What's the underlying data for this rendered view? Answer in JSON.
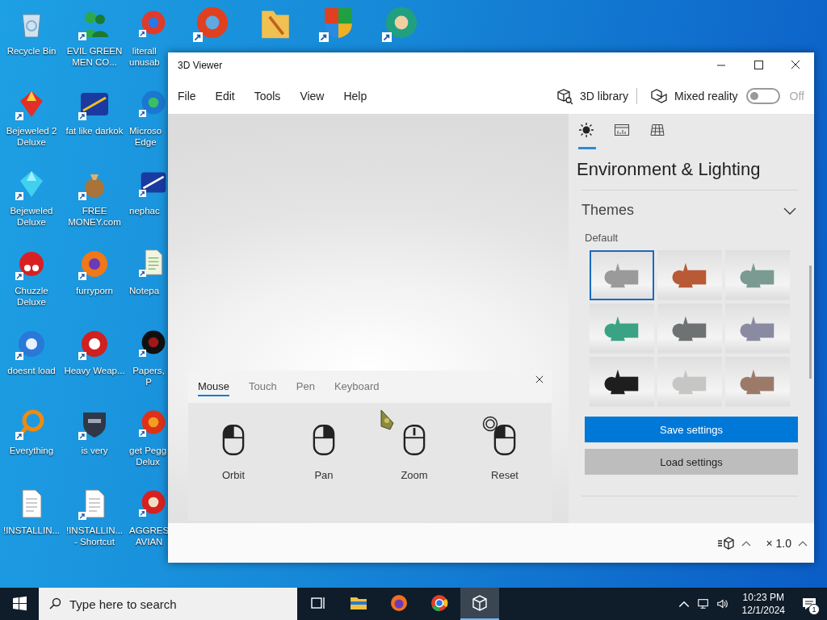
{
  "desktop": {
    "columns": [
      {
        "icons": [
          {
            "label": "Recycle Bin",
            "shortcut": false
          },
          {
            "label": "Bejeweled 2 Deluxe",
            "shortcut": true
          },
          {
            "label": "Bejeweled Deluxe",
            "shortcut": true
          },
          {
            "label": "Chuzzle Deluxe",
            "shortcut": true
          },
          {
            "label": "doesnt load",
            "shortcut": true
          },
          {
            "label": "Everything",
            "shortcut": true
          },
          {
            "label": "!INSTALLIN...",
            "shortcut": false
          }
        ]
      },
      {
        "icons": [
          {
            "label": "EVIL GREEN MEN CO...",
            "shortcut": true
          },
          {
            "label": "fat like darkok",
            "shortcut": true
          },
          {
            "label": "FREE MONEY.com",
            "shortcut": true
          },
          {
            "label": "furryporn",
            "shortcut": true
          },
          {
            "label": "Heavy Weap...",
            "shortcut": true
          },
          {
            "label": "is very",
            "shortcut": true
          },
          {
            "label": "!INSTALLIN... - Shortcut",
            "shortcut": true
          }
        ]
      },
      {
        "icons": [
          {
            "label": "literall\nunusab",
            "shortcut": true
          },
          {
            "label": "Microso\nEdge",
            "shortcut": true
          },
          {
            "label": "nephac",
            "shortcut": true
          },
          {
            "label": "Notepa",
            "shortcut": true
          },
          {
            "label": "Papers, P",
            "shortcut": true
          },
          {
            "label": "get Pegg\nDelux",
            "shortcut": true
          },
          {
            "label": "AGGRES\nAVIAN",
            "shortcut": true
          }
        ]
      }
    ],
    "top_row_icons": [
      {
        "shortcut": true
      },
      {
        "shortcut": false
      },
      {
        "shortcut": true
      },
      {
        "shortcut": true
      }
    ]
  },
  "window": {
    "title": "3D Viewer",
    "menu": [
      "File",
      "Edit",
      "Tools",
      "View",
      "Help"
    ],
    "library": "3D library",
    "mixed_reality": {
      "label": "Mixed reality",
      "on": false,
      "state_text": "Off"
    }
  },
  "side_panel": {
    "tabs": [
      {
        "selected": true
      },
      {
        "selected": false
      },
      {
        "selected": false
      }
    ],
    "title": "Environment & Lighting",
    "section": {
      "title": "Themes",
      "expanded": true,
      "subtitle": "Default",
      "themes": [
        {
          "selected": true,
          "color": "#9a9a9a"
        },
        {
          "selected": false,
          "color": "#b85a36"
        },
        {
          "selected": false,
          "color": "#7a9a92"
        },
        {
          "selected": false,
          "color": "#3aa383"
        },
        {
          "selected": false,
          "color": "#6e7272"
        },
        {
          "selected": false,
          "color": "#8a8aa2"
        },
        {
          "selected": false,
          "color": "#1e1e1e"
        },
        {
          "selected": false,
          "color": "#c6c6c4"
        },
        {
          "selected": false,
          "color": "#9c7a6a"
        }
      ]
    },
    "buttons": [
      {
        "kind": "primary",
        "label": "Save settings"
      },
      {
        "kind": "secondary",
        "label": "Load settings"
      }
    ]
  },
  "controls_panel": {
    "tabs": [
      {
        "label": "Mouse",
        "selected": true
      },
      {
        "label": "Touch",
        "selected": false
      },
      {
        "label": "Pen",
        "selected": false
      },
      {
        "label": "Keyboard",
        "selected": false
      }
    ],
    "items": [
      {
        "kind": "orbit",
        "label": "Orbit"
      },
      {
        "kind": "pan",
        "label": "Pan"
      },
      {
        "kind": "zoom",
        "label": "Zoom"
      },
      {
        "kind": "reset",
        "label": "Reset"
      }
    ]
  },
  "bottom_bar": {
    "zoom": "× 1.0"
  },
  "taskbar": {
    "search_placeholder": "Type here to search",
    "apps": [
      {
        "active": false
      },
      {
        "active": false
      },
      {
        "active": false
      },
      {
        "active": false
      },
      {
        "active": true
      }
    ],
    "time": "10:23 PM",
    "date": "12/1/2024",
    "notifications": "1"
  }
}
